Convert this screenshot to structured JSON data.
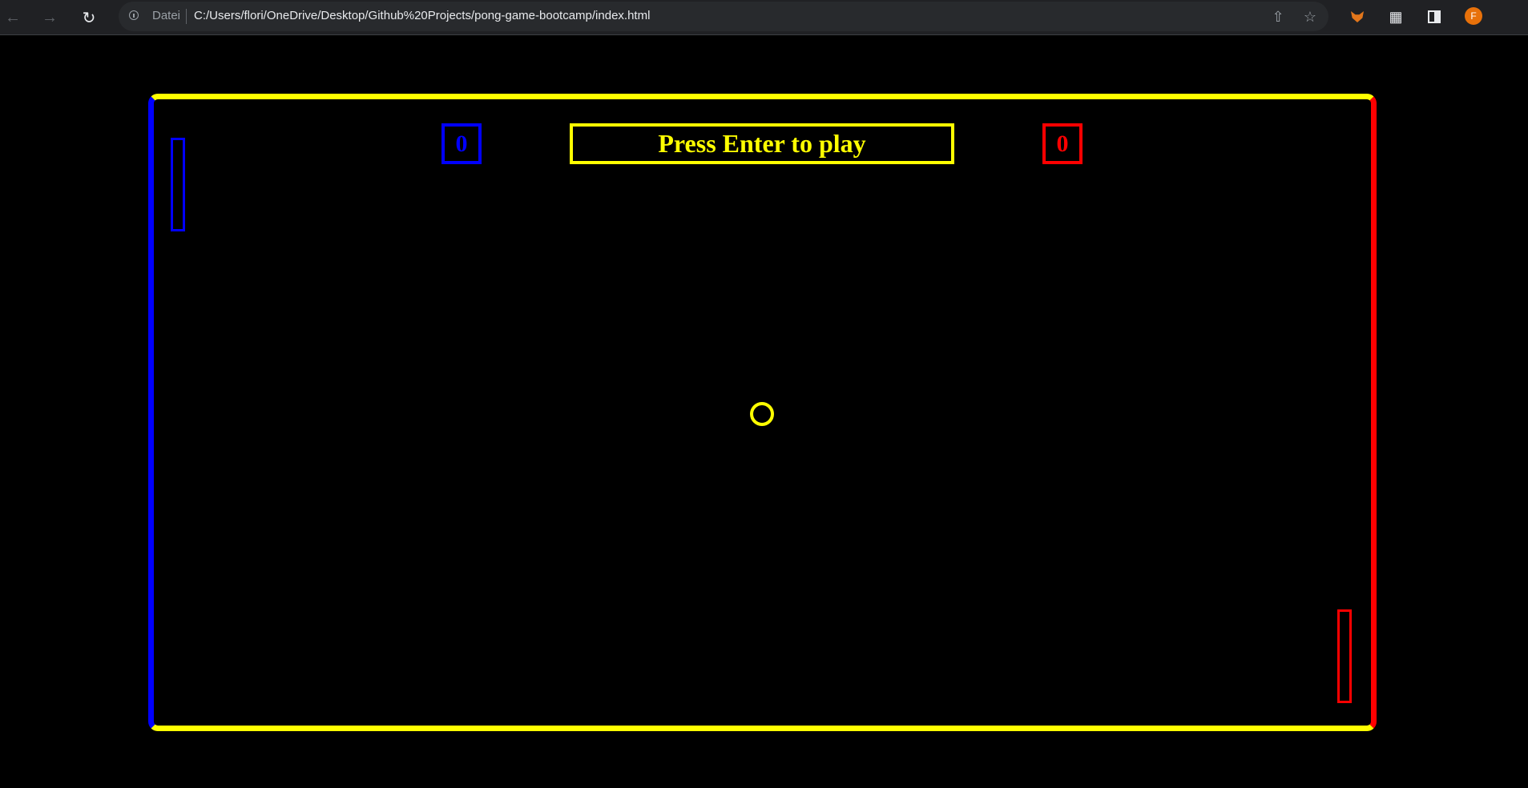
{
  "browser": {
    "scheme_label": "Datei",
    "url": "C:/Users/flori/OneDrive/Desktop/Github%20Projects/pong-game-bootcamp/index.html",
    "profile_initial": "F",
    "icons": {
      "back": "arrow-left-icon",
      "forward": "arrow-right-icon",
      "reload": "reload-icon",
      "info": "info-icon",
      "share": "share-icon",
      "bookmark": "star-icon",
      "extension_fox": "metamask-fox-icon",
      "extensions": "puzzle-icon",
      "side_panel": "side-panel-icon"
    }
  },
  "game": {
    "message": "Press Enter to play",
    "score_left": "0",
    "score_right": "0",
    "colors": {
      "top_bottom_border": "#ffff00",
      "left_side": "#0000ff",
      "right_side": "#ff0000",
      "ball": "#ffff00",
      "background": "#000000"
    }
  }
}
